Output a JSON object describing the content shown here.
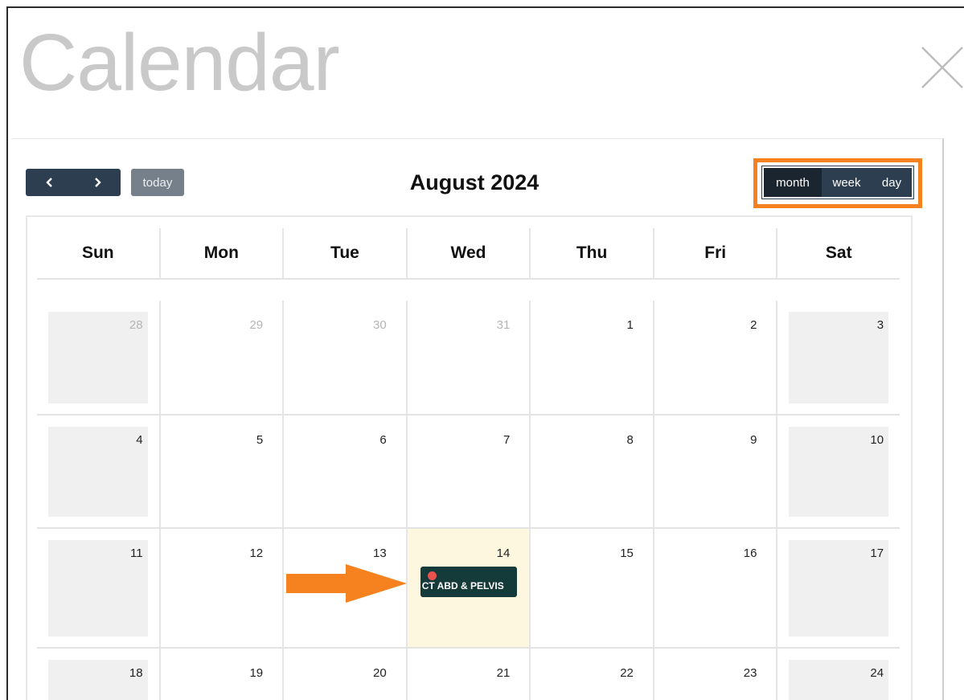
{
  "dialog": {
    "title": "Calendar"
  },
  "toolbar": {
    "prev_icon": "chevron-left-icon",
    "next_icon": "chevron-right-icon",
    "today_label": "today",
    "month_title": "August 2024",
    "views": [
      "month",
      "week",
      "day"
    ],
    "active_view": "month"
  },
  "day_headers": [
    "Sun",
    "Mon",
    "Tue",
    "Wed",
    "Thu",
    "Fri",
    "Sat"
  ],
  "weeks": [
    [
      "28",
      "29",
      "30",
      "31",
      "1",
      "2",
      "3"
    ],
    [
      "4",
      "5",
      "6",
      "7",
      "8",
      "9",
      "10"
    ],
    [
      "11",
      "12",
      "13",
      "14",
      "15",
      "16",
      "17"
    ],
    [
      "18",
      "19",
      "20",
      "21",
      "22",
      "23",
      "24"
    ]
  ],
  "event": {
    "title": "CT ABD & PELVIS",
    "date": "14"
  },
  "colors": {
    "nav": "#2c3e50",
    "today_bg": "#fdf7e0",
    "highlight": "#f5821f",
    "event_bg": "#153a3a",
    "event_dot": "#e8524f"
  }
}
